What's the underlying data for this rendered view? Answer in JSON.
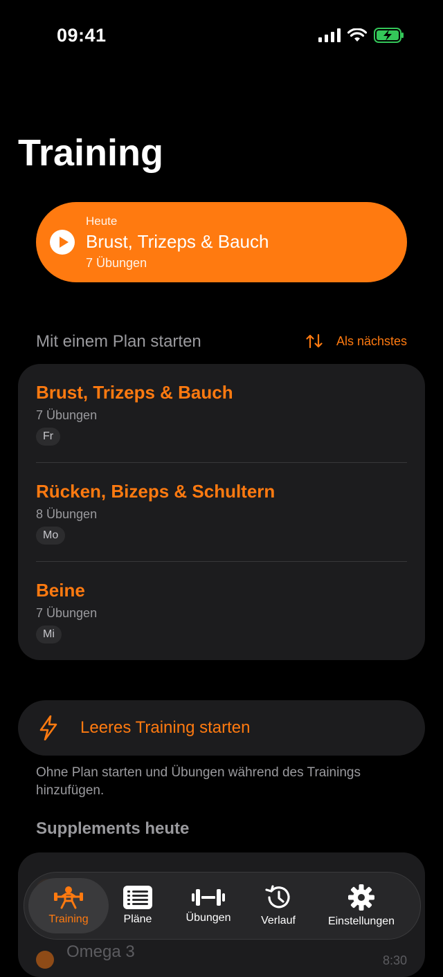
{
  "status_bar": {
    "time": "09:41"
  },
  "page": {
    "title": "Training"
  },
  "today": {
    "label": "Heute",
    "title": "Brust, Trizeps & Bauch",
    "count": "7 Übungen"
  },
  "plans_section": {
    "heading": "Mit einem Plan starten",
    "sort_label": "Als nächstes"
  },
  "plans": [
    {
      "name": "Brust, Trizeps & Bauch",
      "count": "7 Übungen",
      "day": "Fr"
    },
    {
      "name": "Rücken, Bizeps & Schultern",
      "count": "8 Übungen",
      "day": "Mo"
    },
    {
      "name": "Beine",
      "count": "7 Übungen",
      "day": "Mi"
    }
  ],
  "empty_workout": {
    "label": "Leeres Training starten",
    "hint": "Ohne Plan starten und Übungen während des Trainings hinzufügen."
  },
  "supplements": {
    "heading": "Supplements heute",
    "item": "Omega 3",
    "time": "8:30"
  },
  "tabs": [
    {
      "label": "Training",
      "icon": "weightlifter-icon",
      "active": true
    },
    {
      "label": "Pläne",
      "icon": "list-icon"
    },
    {
      "label": "Übungen",
      "icon": "dumbbell-icon"
    },
    {
      "label": "Verlauf",
      "icon": "history-icon"
    },
    {
      "label": "Einstellungen",
      "icon": "gear-icon"
    }
  ],
  "colors": {
    "accent": "#ff7a10",
    "background": "#000000",
    "card": "#1c1c1e",
    "secondary_text": "#9a9a9e",
    "battery": "#34c759"
  }
}
